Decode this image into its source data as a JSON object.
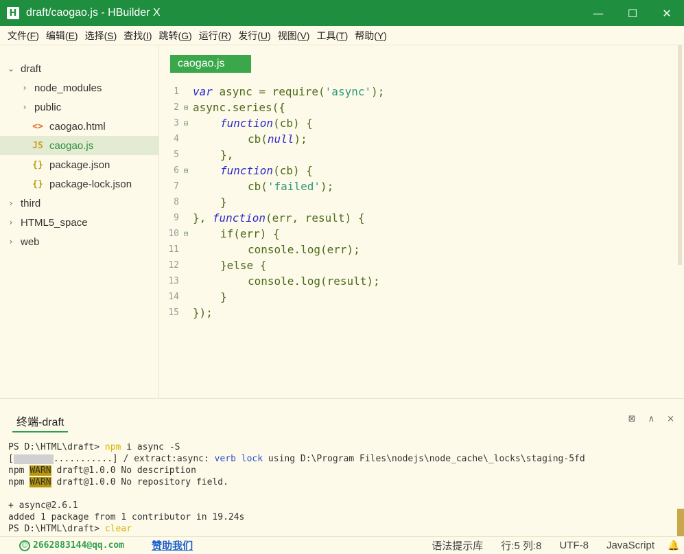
{
  "window": {
    "app_logo": "H",
    "title": "draft/caogao.js - HBuilder X",
    "minimize": "—",
    "maximize": "☐",
    "close": "✕"
  },
  "menu": [
    {
      "label": "文件(",
      "key": "F",
      "end": ")"
    },
    {
      "label": "编辑(",
      "key": "E",
      "end": ")"
    },
    {
      "label": "选择(",
      "key": "S",
      "end": ")"
    },
    {
      "label": "查找(",
      "key": "I",
      "end": ")"
    },
    {
      "label": "跳转(",
      "key": "G",
      "end": ")"
    },
    {
      "label": "运行(",
      "key": "R",
      "end": ")"
    },
    {
      "label": "发行(",
      "key": "U",
      "end": ")"
    },
    {
      "label": "视图(",
      "key": "V",
      "end": ")"
    },
    {
      "label": "工具(",
      "key": "T",
      "end": ")"
    },
    {
      "label": "帮助(",
      "key": "Y",
      "end": ")"
    }
  ],
  "sidebar": {
    "items": [
      {
        "label": "draft",
        "chev": "⌄",
        "icon": "",
        "icon_name": "folder-expanded"
      },
      {
        "label": "node_modules",
        "chev": "›",
        "icon": "",
        "icon_name": "folder-collapsed"
      },
      {
        "label": "public",
        "chev": "›",
        "icon": "",
        "icon_name": "folder-collapsed"
      },
      {
        "label": "caogao.html",
        "chev": "",
        "icon": "<>",
        "icon_name": "html-file-icon"
      },
      {
        "label": "caogao.js",
        "chev": "",
        "icon": "JS",
        "icon_name": "js-file-icon"
      },
      {
        "label": "package.json",
        "chev": "",
        "icon": "{}",
        "icon_name": "json-file-icon"
      },
      {
        "label": "package-lock.json",
        "chev": "",
        "icon": "{}",
        "icon_name": "json-file-icon"
      },
      {
        "label": "third",
        "chev": "›",
        "icon": "",
        "icon_name": "folder-collapsed"
      },
      {
        "label": "HTML5_space",
        "chev": "›",
        "icon": "",
        "icon_name": "folder-collapsed"
      },
      {
        "label": "web",
        "chev": "›",
        "icon": "",
        "icon_name": "folder-collapsed"
      }
    ]
  },
  "editor": {
    "tab_label": "caogao.js",
    "lines": [
      {
        "n": "1",
        "fold": ""
      },
      {
        "n": "2",
        "fold": "⊟"
      },
      {
        "n": "3",
        "fold": "⊟"
      },
      {
        "n": "4",
        "fold": ""
      },
      {
        "n": "5",
        "fold": ""
      },
      {
        "n": "6",
        "fold": "⊟"
      },
      {
        "n": "7",
        "fold": ""
      },
      {
        "n": "8",
        "fold": ""
      },
      {
        "n": "9",
        "fold": ""
      },
      {
        "n": "10",
        "fold": "⊟"
      },
      {
        "n": "11",
        "fold": ""
      },
      {
        "n": "12",
        "fold": ""
      },
      {
        "n": "13",
        "fold": ""
      },
      {
        "n": "14",
        "fold": ""
      },
      {
        "n": "15",
        "fold": ""
      }
    ],
    "code": {
      "l1_kw": "var",
      "l1_a": " async = require(",
      "l1_str": "'async'",
      "l1_b": ");",
      "l2": "async.series({",
      "l3_kw": "function",
      "l3_b": "(cb) {",
      "l4_a": "cb(",
      "l4_kw": "null",
      "l4_b": ");",
      "l5": "},",
      "l6_kw": "function",
      "l6_b": "(cb) {",
      "l7_a": "cb(",
      "l7_str": "'failed'",
      "l7_b": ");",
      "l8": "}",
      "l9_a": "}, ",
      "l9_kw": "function",
      "l9_b": "(err, result) {",
      "l10": "if(err) {",
      "l11": "console.log(err);",
      "l12": "}else {",
      "l13": "console.log(result);",
      "l14": "}",
      "l15": "});"
    }
  },
  "terminal": {
    "tab_label": "终端-draft",
    "action_new": "⊠",
    "action_collapse": "∧",
    "action_close": "×",
    "l1_prompt": "PS D:\\HTML\\draft> ",
    "l1_cmd": "npm",
    "l1_rest": " i async -S",
    "l2_a": "[",
    "l2_b": "...........] / extract:async: ",
    "l2_verb": "verb",
    "l2_lock": " lock",
    "l2_rest": " using D:\\Program Files\\nodejs\\node_cache\\_locks\\staging-5fd",
    "l3_npm": "npm ",
    "l3_warn": "WARN",
    "l3_rest": " draft@1.0.0 No description",
    "l4_npm": "npm ",
    "l4_warn": "WARN",
    "l4_rest": " draft@1.0.0 No repository field.",
    "l5": "",
    "l6": "+ async@2.6.1",
    "l7": "added 1 package from 1 contributor in 19.24s",
    "l8_prompt": "PS D:\\HTML\\draft> ",
    "l8_cmd": "clear"
  },
  "status": {
    "user_icon": "☺",
    "user": "2662883144@qq.com",
    "sponsor": "赞助我们",
    "syntax": "语法提示库",
    "position": "行:5  列:8",
    "encoding": "UTF-8",
    "language": "JavaScript",
    "bell": "🔔"
  }
}
